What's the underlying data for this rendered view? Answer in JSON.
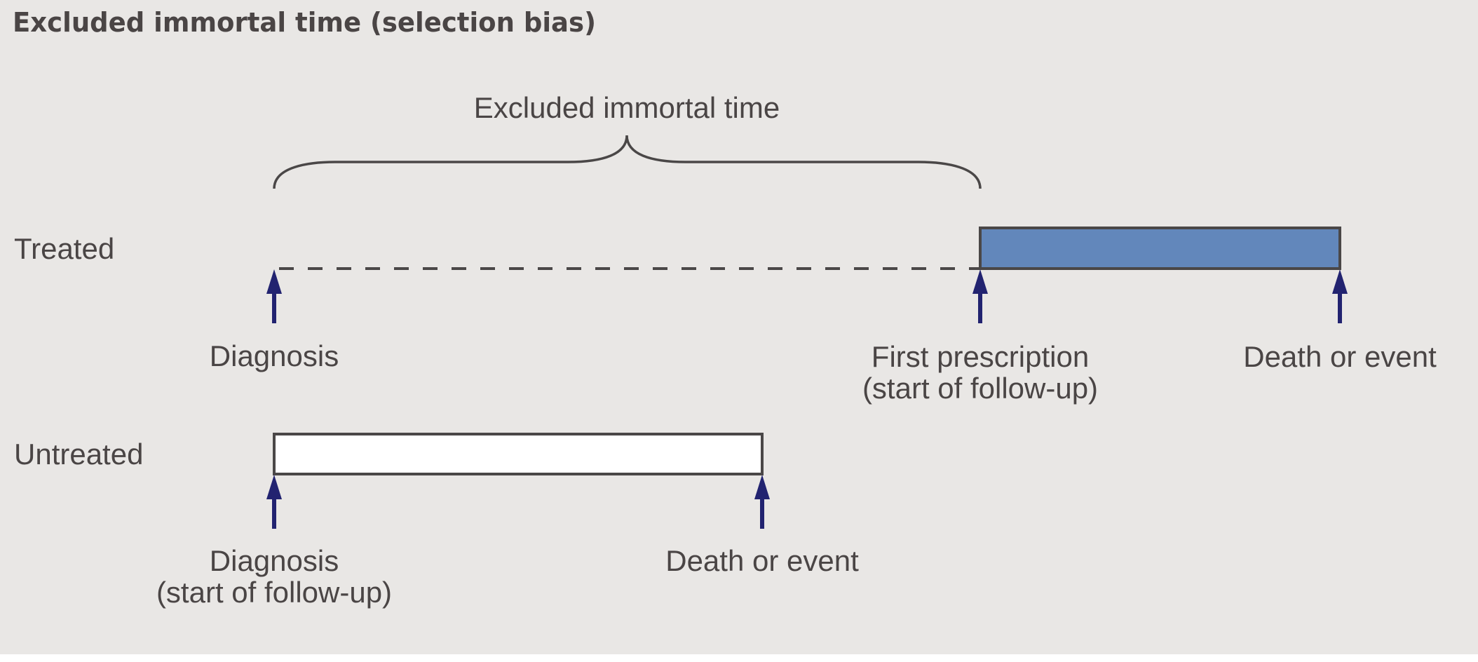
{
  "title": "Excluded immortal time (selection bias)",
  "colors": {
    "background": "#e9e7e5",
    "treated_fill": "#6287bb",
    "untreated_fill": "#ffffff",
    "outline": "#4a4747",
    "arrow": "#222370",
    "text": "#4a4545"
  },
  "brace": {
    "label": "Excluded immortal time",
    "from_event": "diagnosis",
    "to_event": "first_prescription"
  },
  "rows": [
    {
      "name": "Treated",
      "events": [
        {
          "id": "diagnosis",
          "lines": [
            "Diagnosis"
          ]
        },
        {
          "id": "first_prescription",
          "lines": [
            "First prescription",
            "(start of follow-up)"
          ]
        },
        {
          "id": "death",
          "lines": [
            "Death or event"
          ]
        }
      ],
      "segments": [
        {
          "from": "diagnosis",
          "to": "first_prescription",
          "style": "dashed"
        },
        {
          "from": "first_prescription",
          "to": "death",
          "style": "bar",
          "fill": "treated"
        }
      ]
    },
    {
      "name": "Untreated",
      "events": [
        {
          "id": "diagnosis",
          "lines": [
            "Diagnosis",
            "(start of follow-up)"
          ]
        },
        {
          "id": "death",
          "lines": [
            "Death or event"
          ]
        }
      ],
      "segments": [
        {
          "from": "diagnosis",
          "to": "death",
          "style": "bar",
          "fill": "untreated"
        }
      ]
    }
  ]
}
